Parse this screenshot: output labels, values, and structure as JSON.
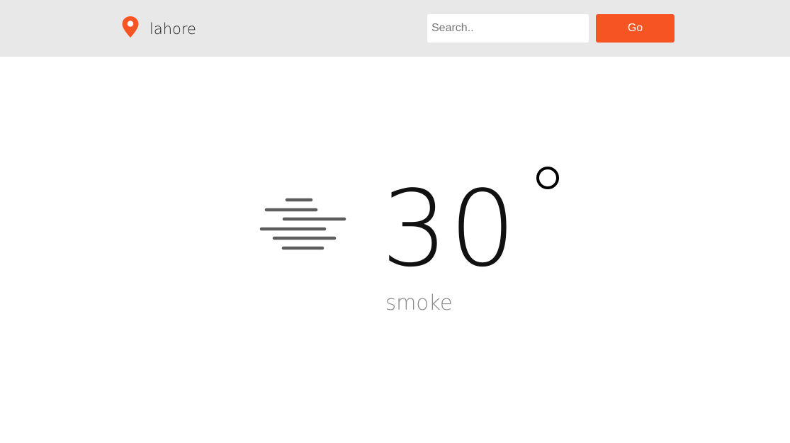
{
  "header": {
    "location_icon": "map-pin-icon",
    "city": "lahore",
    "search": {
      "placeholder": "Search..",
      "value": ""
    },
    "go_label": "Go"
  },
  "weather": {
    "icon": "smoke-haze-icon",
    "temperature": "30",
    "degree_icon": "degree-symbol",
    "condition": "smoke"
  },
  "colors": {
    "accent": "#f75423",
    "header_bg": "#e8e8e8",
    "condition_text": "#8a8a8a"
  }
}
